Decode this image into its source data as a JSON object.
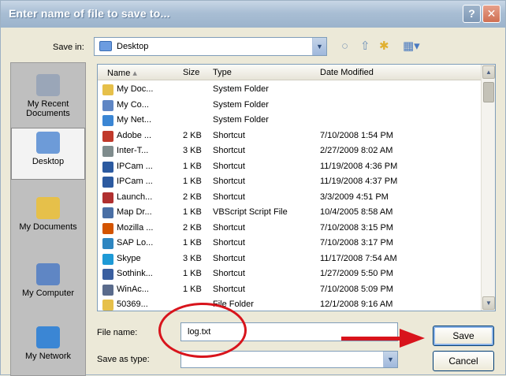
{
  "window": {
    "title": "Enter name of file to save to...",
    "help": "?",
    "close": "✕"
  },
  "savein": {
    "label": "Save in:",
    "value": "Desktop"
  },
  "places": [
    {
      "label": "My Recent Documents",
      "color": "#9aa6b8"
    },
    {
      "label": "Desktop",
      "color": "#6d9bd8"
    },
    {
      "label": "My Documents",
      "color": "#e6c04a"
    },
    {
      "label": "My Computer",
      "color": "#5f86c4"
    },
    {
      "label": "My Network",
      "color": "#3b86d4"
    }
  ],
  "columns": {
    "name": "Name",
    "size": "Size",
    "type": "Type",
    "date": "Date Modified"
  },
  "files": [
    {
      "name": "My Doc...",
      "size": "",
      "type": "System Folder",
      "date": "",
      "color": "#e6c04a"
    },
    {
      "name": "My Co...",
      "size": "",
      "type": "System Folder",
      "date": "",
      "color": "#5f86c4"
    },
    {
      "name": "My Net...",
      "size": "",
      "type": "System Folder",
      "date": "",
      "color": "#3b86d4"
    },
    {
      "name": "Adobe ...",
      "size": "2 KB",
      "type": "Shortcut",
      "date": "7/10/2008 1:54 PM",
      "color": "#c0392b"
    },
    {
      "name": "Inter-T...",
      "size": "3 KB",
      "type": "Shortcut",
      "date": "2/27/2009 8:02 AM",
      "color": "#7f8c8d"
    },
    {
      "name": "IPCam ...",
      "size": "1 KB",
      "type": "Shortcut",
      "date": "11/19/2008 4:36 PM",
      "color": "#2c5aa0"
    },
    {
      "name": "IPCam ...",
      "size": "1 KB",
      "type": "Shortcut",
      "date": "11/19/2008 4:37 PM",
      "color": "#2c5aa0"
    },
    {
      "name": "Launch...",
      "size": "2 KB",
      "type": "Shortcut",
      "date": "3/3/2009 4:51 PM",
      "color": "#b03030"
    },
    {
      "name": "Map Dr...",
      "size": "1 KB",
      "type": "VBScript Script File",
      "date": "10/4/2005 8:58 AM",
      "color": "#4a6fa5"
    },
    {
      "name": "Mozilla ...",
      "size": "2 KB",
      "type": "Shortcut",
      "date": "7/10/2008 3:15 PM",
      "color": "#d35400"
    },
    {
      "name": "SAP Lo...",
      "size": "1 KB",
      "type": "Shortcut",
      "date": "7/10/2008 3:17 PM",
      "color": "#2e86c1"
    },
    {
      "name": "Skype",
      "size": "3 KB",
      "type": "Shortcut",
      "date": "11/17/2008 7:54 AM",
      "color": "#1e9ad6"
    },
    {
      "name": "Sothink...",
      "size": "1 KB",
      "type": "Shortcut",
      "date": "1/27/2009 5:50 PM",
      "color": "#3a5fa0"
    },
    {
      "name": "WinAc...",
      "size": "1 KB",
      "type": "Shortcut",
      "date": "7/10/2008 5:09 PM",
      "color": "#5a6b8c"
    },
    {
      "name": "50369...",
      "size": "",
      "type": "File Folder",
      "date": "12/1/2008 9:16 AM",
      "color": "#e6c04a"
    }
  ],
  "filename": {
    "label": "File name:",
    "value": "log.txt"
  },
  "savetype": {
    "label": "Save as type:",
    "value": ""
  },
  "buttons": {
    "save": "Save",
    "cancel": "Cancel"
  }
}
